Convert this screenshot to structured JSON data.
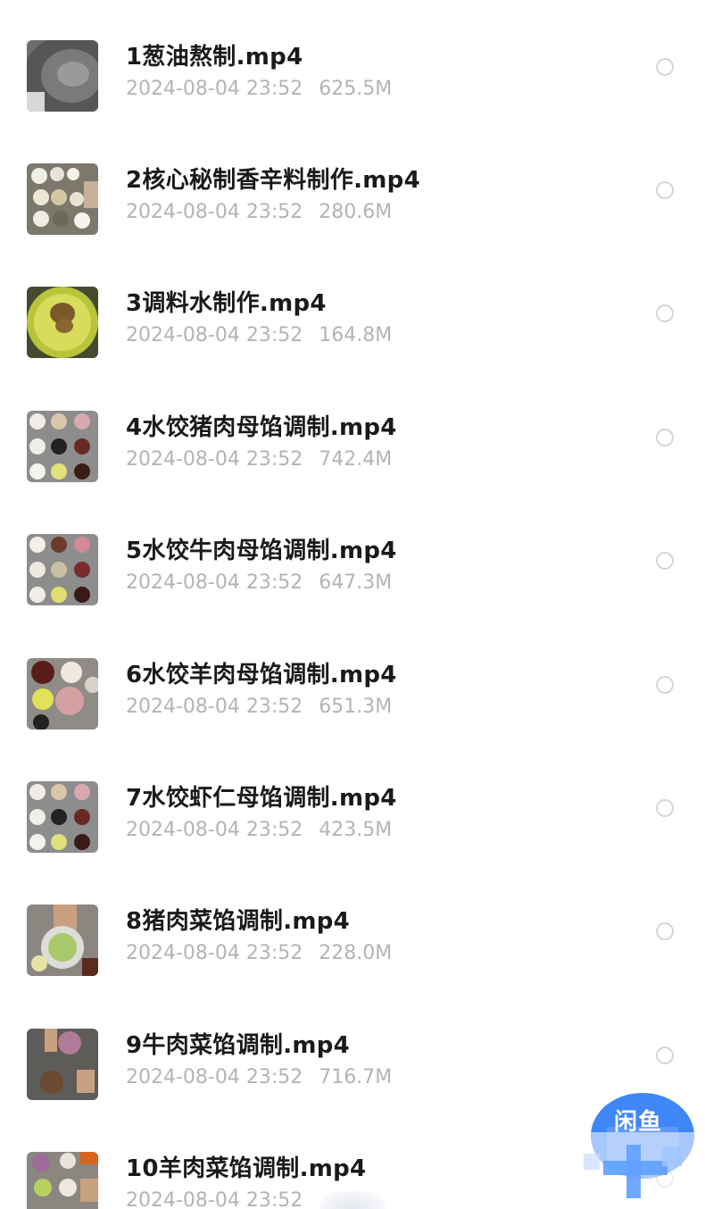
{
  "files": [
    {
      "name": "1葱油熬制.mp4",
      "date": "2024-08-04 23:52",
      "size": "625.5M",
      "thumb_icon": "wok-thumbnail"
    },
    {
      "name": "2核心秘制香辛料制作.mp4",
      "date": "2024-08-04 23:52",
      "size": "280.6M",
      "thumb_icon": "spice-bowls-thumbnail"
    },
    {
      "name": "3调料水制作.mp4",
      "date": "2024-08-04 23:52",
      "size": "164.8M",
      "thumb_icon": "yellow-pot-thumbnail"
    },
    {
      "name": "4水饺猪肉母馅调制.mp4",
      "date": "2024-08-04 23:52",
      "size": "742.4M",
      "thumb_icon": "ingredient-bowls-thumbnail"
    },
    {
      "name": "5水饺牛肉母馅调制.mp4",
      "date": "2024-08-04 23:52",
      "size": "647.3M",
      "thumb_icon": "ingredient-bowls-thumbnail"
    },
    {
      "name": "6水饺羊肉母馅调制.mp4",
      "date": "2024-08-04 23:52",
      "size": "651.3M",
      "thumb_icon": "meat-bowls-thumbnail"
    },
    {
      "name": "7水饺虾仁母馅调制.mp4",
      "date": "2024-08-04 23:52",
      "size": "423.5M",
      "thumb_icon": "ingredient-bowls-thumbnail"
    },
    {
      "name": "8猪肉菜馅调制.mp4",
      "date": "2024-08-04 23:52",
      "size": "228.0M",
      "thumb_icon": "mixing-bowl-thumbnail"
    },
    {
      "name": "9牛肉菜馅调制.mp4",
      "date": "2024-08-04 23:52",
      "size": "716.7M",
      "thumb_icon": "mixing-hands-thumbnail"
    },
    {
      "name": "10羊肉菜馅调制.mp4",
      "date": "2024-08-04 23:52",
      "size": "",
      "thumb_icon": "vegetable-bowls-thumbnail"
    }
  ],
  "watermark": {
    "text": "闲鱼",
    "icon": "xianyu-logo",
    "color": "#2f7cf6"
  },
  "colors": {
    "name": "#1a1a1a",
    "meta": "#b4b4b4",
    "radio_border": "#d6d6d6"
  }
}
